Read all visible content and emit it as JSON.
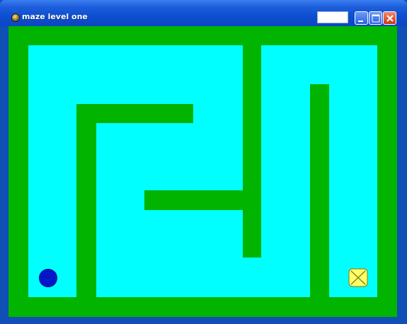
{
  "window": {
    "title": "maze level one",
    "colors": {
      "title_text": "#ffffff",
      "titlebar": "#0d4fd0",
      "wall": "#00b400",
      "floor": "#00ffff",
      "player": "#0018c8",
      "goal": "#ffff66"
    },
    "controls": {
      "minimize_icon": "minimize-icon",
      "maximize_icon": "maximize-icon",
      "close_icon": "close-icon"
    }
  },
  "maze": {
    "player_icon": "circle",
    "goal_icon": "crossed-box"
  }
}
